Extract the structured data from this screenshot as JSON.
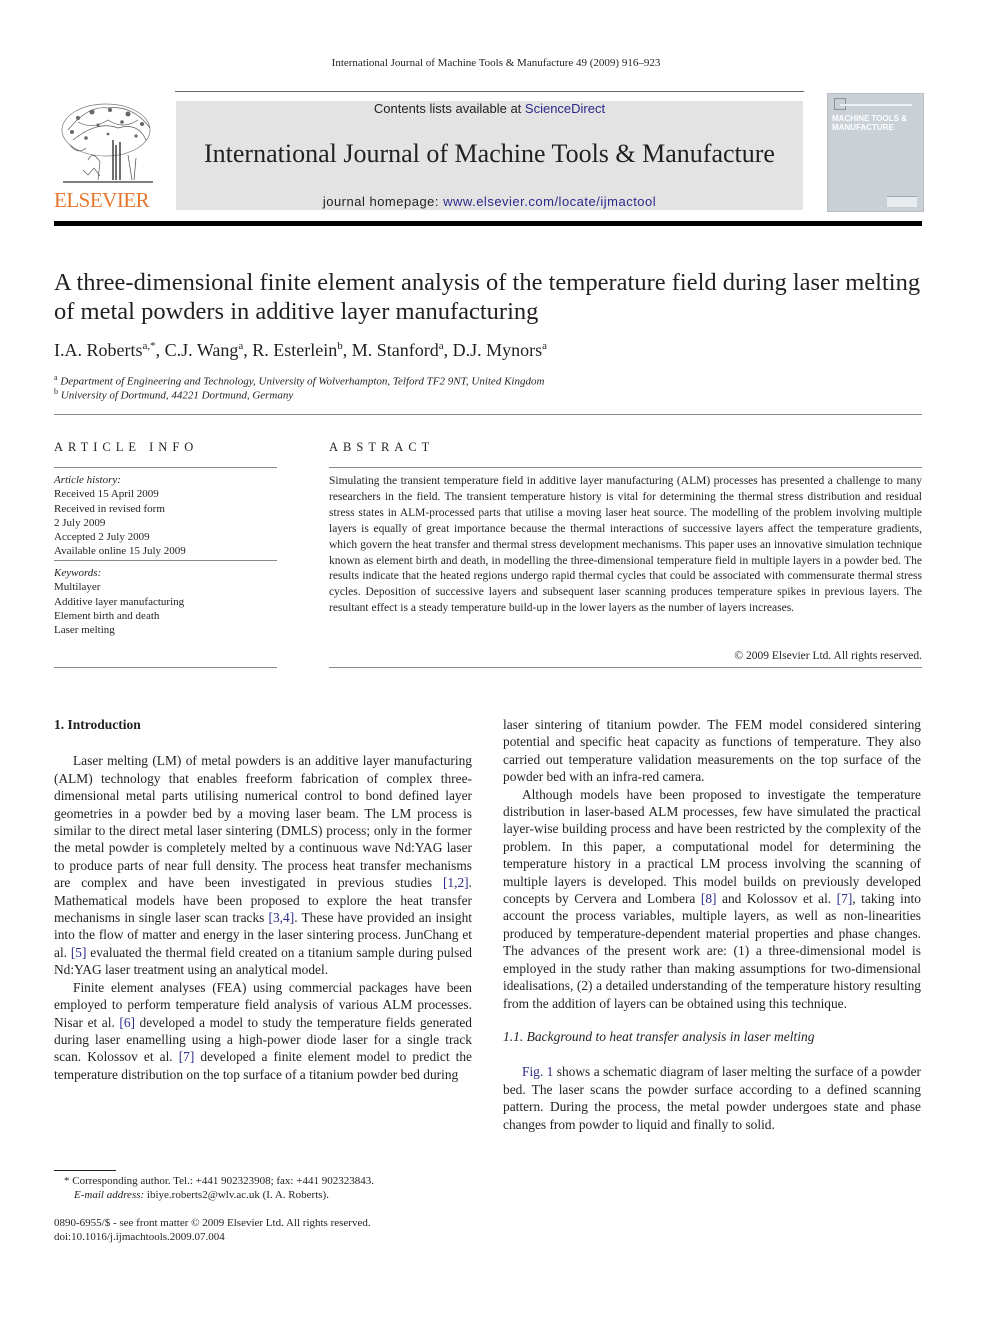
{
  "running_head": "International Journal of Machine Tools & Manufacture 49 (2009) 916–923",
  "publisher": {
    "name": "ELSEVIER",
    "logo_icon": "elsevier-tree-logo",
    "brand_color": "#e8772e"
  },
  "banner": {
    "contents_prefix": "Contents lists available at ",
    "contents_link": "ScienceDirect",
    "journal_name": "International Journal of Machine Tools & Manufacture",
    "homepage_prefix": "journal homepage: ",
    "homepage_link": "www.elsevier.com/locate/ijmactool",
    "link_color": "#2a2a8a",
    "background_color": "#e3e3e3"
  },
  "cover": {
    "title": "MACHINE TOOLS & MANUFACTURE",
    "background_color": "#c9d0d6"
  },
  "article": {
    "title": "A three-dimensional finite element analysis of the temperature field during laser melting of metal powders in additive layer manufacturing",
    "authors": [
      {
        "name": "I.A. Roberts",
        "sup": "a,*"
      },
      {
        "name": "C.J. Wang",
        "sup": "a"
      },
      {
        "name": "R. Esterlein",
        "sup": "b"
      },
      {
        "name": "M. Stanford",
        "sup": "a"
      },
      {
        "name": "D.J. Mynors",
        "sup": "a"
      }
    ],
    "affiliations": [
      {
        "sup": "a",
        "text": "Department of Engineering and Technology, University of Wolverhampton, Telford TF2 9NT, United Kingdom"
      },
      {
        "sup": "b",
        "text": "University of Dortmund, 44221 Dortmund, Germany"
      }
    ]
  },
  "article_info": {
    "heading": "ARTICLE INFO",
    "history_label": "Article history:",
    "history": [
      "Received 15 April 2009",
      "Received in revised form",
      "2 July 2009",
      "Accepted 2 July 2009",
      "Available online 15 July 2009"
    ],
    "keywords_label": "Keywords:",
    "keywords": [
      "Multilayer",
      "Additive layer manufacturing",
      "Element birth and death",
      "Laser melting"
    ]
  },
  "abstract": {
    "heading": "ABSTRACT",
    "text": "Simulating the transient temperature field in additive layer manufacturing (ALM) processes has presented a challenge to many researchers in the field. The transient temperature history is vital for determining the thermal stress distribution and residual stress states in ALM-processed parts that utilise a moving laser heat source. The modelling of the problem involving multiple layers is equally of great importance because the thermal interactions of successive layers affect the temperature gradients, which govern the heat transfer and thermal stress development mechanisms. This paper uses an innovative simulation technique known as element birth and death, in modelling the three-dimensional temperature field in multiple layers in a powder bed. The results indicate that the heated regions undergo rapid thermal cycles that could be associated with commensurate thermal stress cycles. Deposition of successive layers and subsequent laser scanning produces temperature spikes in previous layers. The resultant effect is a steady temperature build-up in the lower layers as the number of layers increases.",
    "copyright": "© 2009 Elsevier Ltd. All rights reserved."
  },
  "body": {
    "section1_heading": "1.  Introduction",
    "left_p1": [
      "Laser melting (LM) of metal powders is an additive layer manufacturing (ALM) technology that enables freeform fabrication of complex three-dimensional metal parts utilising numerical control to bond defined layer geometries in a powder bed by a moving laser beam. The LM process is similar to the direct metal laser sintering (DMLS) process; only in the former the metal powder is completely melted by a continuous wave Nd:YAG laser to produce parts of near full density. The process heat transfer mechanisms are complex and have been investigated in previous studies ",
      "[1,2]",
      ". Mathematical models have been proposed to explore the heat transfer mechanisms in single laser scan tracks ",
      "[3,4]",
      ". These have provided an insight into the flow of matter and energy in the laser sintering process. JunChang et al. ",
      "[5]",
      " evaluated the thermal field created on a titanium sample during pulsed Nd:YAG laser treatment using an analytical model."
    ],
    "left_p2": [
      "Finite element analyses (FEA) using commercial packages have been employed to perform temperature field analysis of various ALM processes. Nisar et al. ",
      "[6]",
      " developed a model to study the temperature fields generated during laser enamelling using a high-power diode laser for a single track scan. Kolossov et al. ",
      "[7]",
      " developed a finite element model to predict the temperature distribution on the top surface of a titanium powder bed during"
    ],
    "right_p1": "laser sintering of titanium powder. The FEM model considered sintering potential and specific heat capacity as functions of temperature. They also carried out temperature validation measurements on the top surface of the powder bed with an infra-red camera.",
    "right_p2": [
      "Although models have been proposed to investigate the temperature distribution in laser-based ALM processes, few have simulated the practical layer-wise building process and have been restricted by the complexity of the problem. In this paper, a computational model for determining the temperature history in a practical LM process involving the scanning of multiple layers is developed. This model builds on previously developed concepts by Cervera and Lombera ",
      "[8]",
      " and Kolossov et al. ",
      "[7]",
      ", taking into account the process variables, multiple layers, as well as non-linearities produced by temperature-dependent material properties and phase changes. The advances of the present work are: (1) a three-dimensional model is employed in the study rather than making assumptions for two-dimensional idealisations, (2) a detailed understanding of the temperature history resulting from the addition of layers can be obtained using this technique."
    ],
    "subsection_heading": "1.1.  Background to heat transfer analysis in laser melting",
    "right_p3": [
      "Fig. 1",
      " shows a schematic diagram of laser melting the surface of a powder bed. The laser scans the powder surface according to a defined scanning pattern. During the process, the metal powder undergoes state and phase changes from powder to liquid and finally to solid."
    ]
  },
  "footnotes": {
    "corresponding": "* Corresponding author. Tel.: +441 902323908; fax: +441 902323843.",
    "email_label": "E-mail address:",
    "email_rest": " ibiye.roberts2@wlv.ac.uk (I. A. Roberts).",
    "issn": "0890-6955/$ - see front matter © 2009 Elsevier Ltd. All rights reserved.",
    "doi": "doi:10.1016/j.ijmachtools.2009.07.004"
  }
}
